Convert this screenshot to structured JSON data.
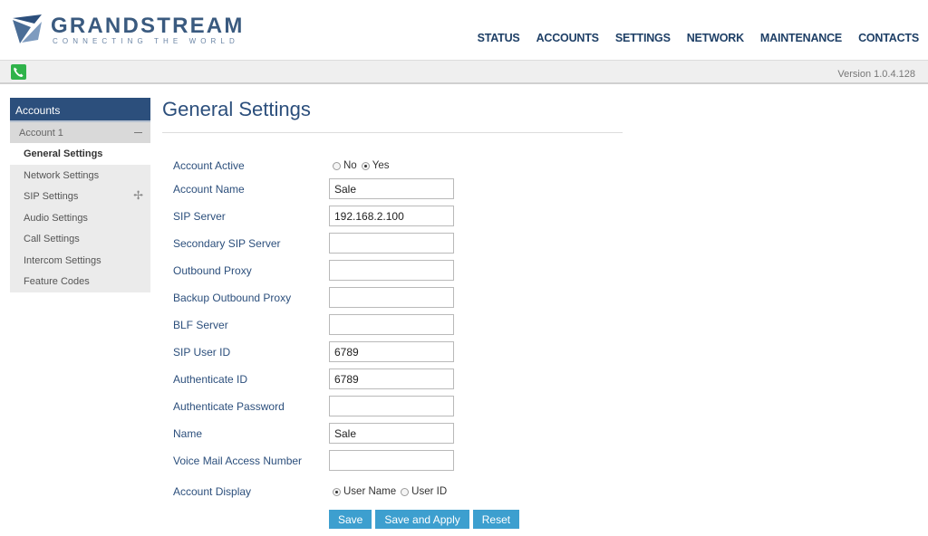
{
  "brand": {
    "name": "GRANDSTREAM",
    "tagline": "CONNECTING THE WORLD"
  },
  "nav": {
    "items": [
      "STATUS",
      "ACCOUNTS",
      "SETTINGS",
      "NETWORK",
      "MAINTENANCE",
      "CONTACTS"
    ]
  },
  "version_bar": {
    "version": "Version 1.0.4.128"
  },
  "sidebar": {
    "header": "Accounts",
    "account": "Account 1",
    "items": [
      {
        "label": "General Settings"
      },
      {
        "label": "Network Settings"
      },
      {
        "label": "SIP Settings"
      },
      {
        "label": "Audio Settings"
      },
      {
        "label": "Call Settings"
      },
      {
        "label": "Intercom Settings"
      },
      {
        "label": "Feature Codes"
      }
    ]
  },
  "page": {
    "title": "General Settings"
  },
  "form": {
    "account_active": {
      "label": "Account Active",
      "opt_no": "No",
      "opt_yes": "Yes",
      "selected": "Yes"
    },
    "fields": [
      {
        "label": "Account Name",
        "value": "Sale"
      },
      {
        "label": "SIP Server",
        "value": "192.168.2.100"
      },
      {
        "label": "Secondary SIP Server",
        "value": ""
      },
      {
        "label": "Outbound Proxy",
        "value": ""
      },
      {
        "label": "Backup Outbound Proxy",
        "value": ""
      },
      {
        "label": "BLF Server",
        "value": ""
      },
      {
        "label": "SIP User ID",
        "value": "6789"
      },
      {
        "label": "Authenticate ID",
        "value": "6789"
      },
      {
        "label": "Authenticate Password",
        "value": ""
      },
      {
        "label": "Name",
        "value": "Sale"
      },
      {
        "label": "Voice Mail Access Number",
        "value": ""
      }
    ],
    "account_display": {
      "label": "Account Display",
      "opt_user_name": "User Name",
      "opt_user_id": "User ID",
      "selected": "User Name"
    }
  },
  "buttons": {
    "save": "Save",
    "save_apply": "Save and Apply",
    "reset": "Reset"
  },
  "colors": {
    "brand_blue": "#2c4f7c",
    "button_blue": "#3d9fcf",
    "phone_green": "#2fb34a"
  }
}
